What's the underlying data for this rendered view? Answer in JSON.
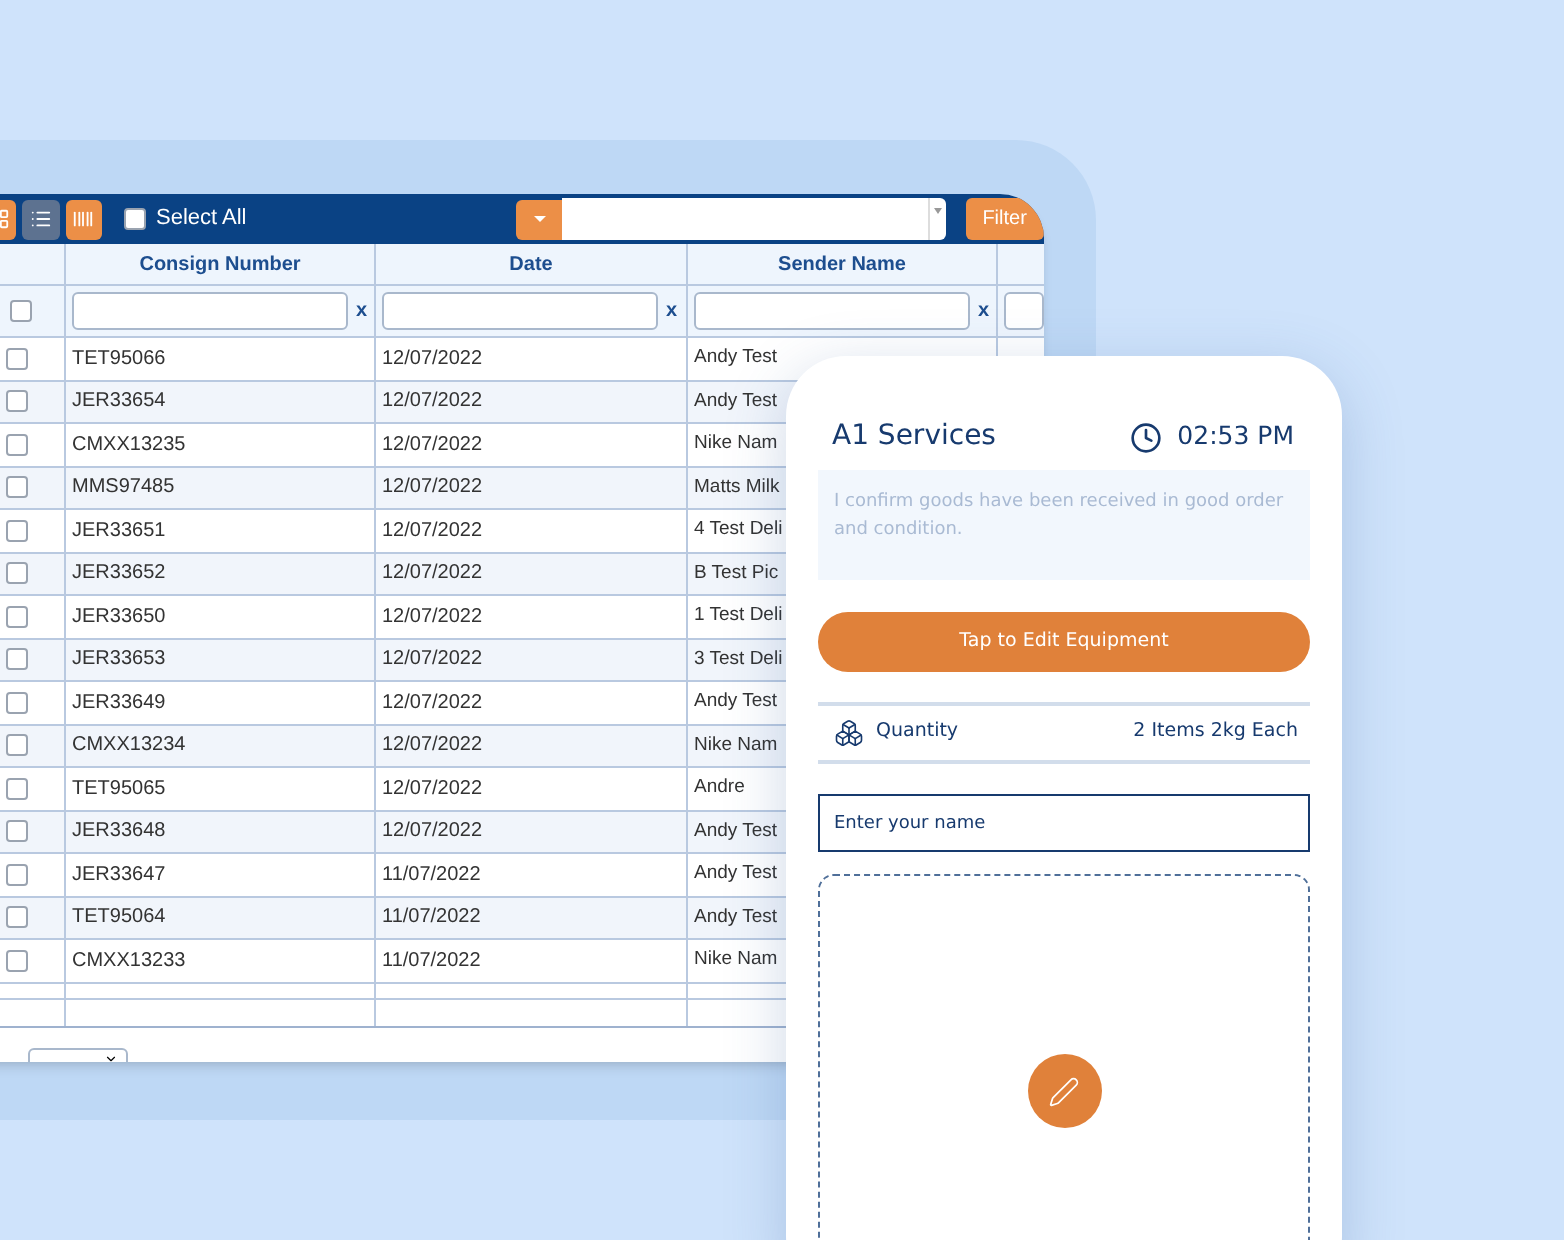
{
  "table_toolbar": {
    "view_buttons": [
      {
        "kind": "grid",
        "selected": false
      },
      {
        "kind": "list",
        "selected": true
      },
      {
        "kind": "barcode",
        "selected": false
      }
    ],
    "select_all": {
      "label": "Select All",
      "checked": false
    },
    "filter_button": "Filter"
  },
  "table": {
    "columns": [
      "Consign Number",
      "Date",
      "Sender Name"
    ],
    "header_checkbox": {
      "checked": false
    },
    "filter_clear_labels": [
      "x",
      "x",
      "x"
    ],
    "rows": [
      {
        "consign": "TET95066",
        "date": "12/07/2022",
        "sender": "Andy Test",
        "checked": false
      },
      {
        "consign": "JER33654",
        "date": "12/07/2022",
        "sender": "Andy Test",
        "checked": false
      },
      {
        "consign": "CMXX13235",
        "date": "12/07/2022",
        "sender": "Nike Nam",
        "checked": false
      },
      {
        "consign": "MMS97485",
        "date": "12/07/2022",
        "sender": "Matts Milk",
        "checked": false
      },
      {
        "consign": "JER33651",
        "date": "12/07/2022",
        "sender": "4 Test Deli",
        "checked": false
      },
      {
        "consign": "JER33652",
        "date": "12/07/2022",
        "sender": "B Test Pic",
        "checked": false
      },
      {
        "consign": "JER33650",
        "date": "12/07/2022",
        "sender": "1 Test Deli",
        "checked": false
      },
      {
        "consign": "JER33653",
        "date": "12/07/2022",
        "sender": "3 Test Deli",
        "checked": false
      },
      {
        "consign": "JER33649",
        "date": "12/07/2022",
        "sender": "Andy Test",
        "checked": false
      },
      {
        "consign": "CMXX13234",
        "date": "12/07/2022",
        "sender": "Nike Nam",
        "checked": false
      },
      {
        "consign": "TET95065",
        "date": "12/07/2022",
        "sender": "Andre",
        "checked": false
      },
      {
        "consign": "JER33648",
        "date": "12/07/2022",
        "sender": "Andy Test",
        "checked": false
      },
      {
        "consign": "JER33647",
        "date": "11/07/2022",
        "sender": "Andy Test",
        "checked": false
      },
      {
        "consign": "TET95064",
        "date": "11/07/2022",
        "sender": "Andy Test",
        "checked": false
      },
      {
        "consign": "CMXX13233",
        "date": "11/07/2022",
        "sender": "Nike Nam",
        "checked": false
      }
    ]
  },
  "mobile": {
    "title": "A1 Services",
    "time": "02:53 PM",
    "confirmation": "I confirm goods have been received in good order and condition.",
    "edit_button": "Tap to Edit Equipment",
    "quantity_label": "Quantity",
    "quantity_value": "2 Items 2kg Each",
    "name_field": {
      "placeholder": "Enter your name"
    }
  }
}
